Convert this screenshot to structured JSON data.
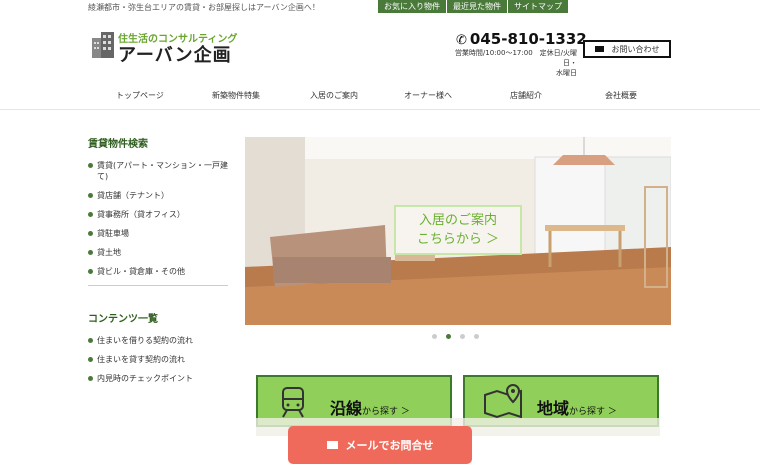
{
  "header": {
    "tagline": "綾瀬都市・弥生台エリアの賃貸・お部屋探しはアーバン企画へ！",
    "toplinks": [
      "お気に入り物件",
      "最近見た物件",
      "サイトマップ"
    ],
    "logo_sub": "住生活のコンサルティング",
    "logo_main": "アーバン企画",
    "phone": "045-810-1332",
    "hours_line1": "営業時間/10:00〜17:00　定休日/火曜日・",
    "hours_line2": "水曜日",
    "contact_label": "お問い合わせ"
  },
  "nav": [
    "トップページ",
    "新築物件特集",
    "入居のご案内",
    "オーナー様へ",
    "店舗紹介",
    "会社概要"
  ],
  "sidebar": {
    "search_heading": "賃貸物件検索",
    "search_items": [
      "賃貸(アパート・マンション・一戸建て)",
      "貸店舗（テナント）",
      "貸事務所（貸オフィス）",
      "貸駐車場",
      "貸土地",
      "貸ビル・貸倉庫・その他"
    ],
    "contents_heading": "コンテンツ一覧",
    "contents_items": [
      "住まいを借りる契約の流れ",
      "住まいを貸す契約の流れ",
      "内見時のチェックポイント"
    ]
  },
  "hero": {
    "line1": "入居のご案内",
    "line2": "こちらから ＞"
  },
  "slider_dots": 4,
  "active_dot": 2,
  "search_by": [
    {
      "main": "沿線",
      "sub": "から探す ＞",
      "icon": "train-icon"
    },
    {
      "main": "地域",
      "sub": "から探す ＞",
      "icon": "map-pin-icon"
    }
  ],
  "mail_bar": "メールでお問合せ",
  "colors": {
    "accent": "#4a7a3a",
    "light_green": "#8fcf5a",
    "mail": "#ef6a5a"
  }
}
